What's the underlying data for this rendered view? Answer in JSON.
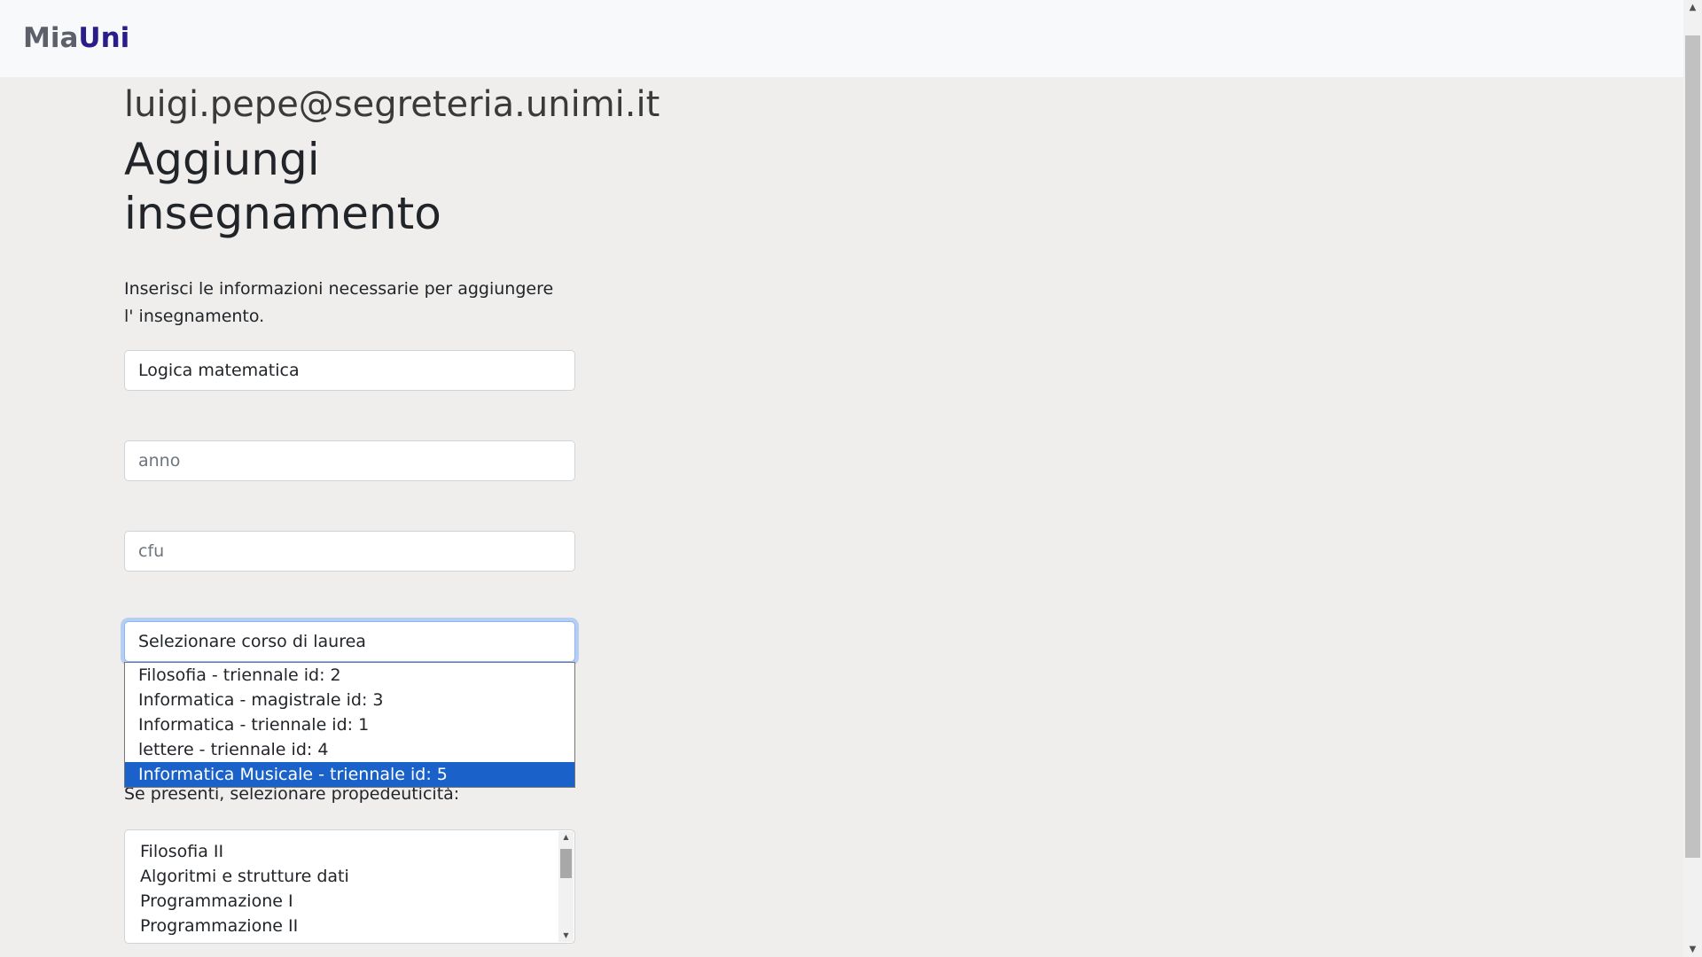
{
  "navbar": {
    "brand_part1": "Mia",
    "brand_part2": "Uni"
  },
  "user": {
    "email": "luigi.pepe@segreteria.unimi.it"
  },
  "page": {
    "title": "Aggiungi insegnamento",
    "intro": "Inserisci le informazioni necessarie per aggiungere l' insegnamento."
  },
  "form": {
    "nome_value": "Logica matematica",
    "anno_placeholder": "anno",
    "cfu_placeholder": "cfu",
    "corso_selected": "Selezionare corso di laurea",
    "corso_options": [
      {
        "label": "Filosofia - triennale id: 2"
      },
      {
        "label": "Informatica - magistrale id: 3"
      },
      {
        "label": "Informatica - triennale id: 1"
      },
      {
        "label": "lettere - triennale id: 4"
      },
      {
        "label": "Informatica Musicale - triennale id: 5"
      }
    ],
    "highlighted_option_index": 4,
    "propedeuticita_label": "Se presenti, selezionare propedeuticità:",
    "propedeuticita_options": [
      {
        "label": "Filosofia II"
      },
      {
        "label": "Algoritmi e strutture dati"
      },
      {
        "label": "Programmazione I"
      },
      {
        "label": "Programmazione II"
      }
    ]
  },
  "icons": {
    "scroll_up": "arrow-up-icon",
    "scroll_down": "arrow-down-icon"
  },
  "colors": {
    "brand_primary": "#2a1d8a",
    "brand_secondary": "#5d5f6a",
    "highlight": "#1a62c9",
    "focus_border": "#86b7fe"
  }
}
